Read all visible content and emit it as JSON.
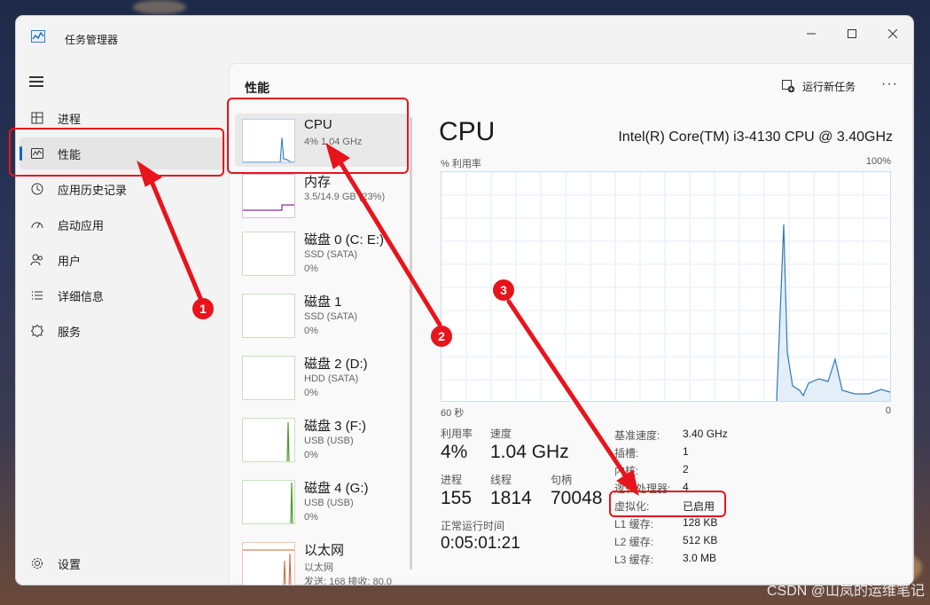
{
  "window": {
    "title": "任务管理器",
    "accent": "#0067c0"
  },
  "nav": {
    "items": [
      {
        "label": "进程",
        "icon": "processes-icon"
      },
      {
        "label": "性能",
        "icon": "performance-icon",
        "active": true
      },
      {
        "label": "应用历史记录",
        "icon": "history-icon"
      },
      {
        "label": "启动应用",
        "icon": "startup-icon"
      },
      {
        "label": "用户",
        "icon": "users-icon"
      },
      {
        "label": "详细信息",
        "icon": "details-icon"
      },
      {
        "label": "服务",
        "icon": "services-icon"
      }
    ],
    "settings": "设置"
  },
  "header": {
    "title": "性能",
    "run_task": "运行新任务",
    "more": "···"
  },
  "resources": [
    {
      "name": "CPU",
      "sub1": "4% 1.04 GHz",
      "sub2": ""
    },
    {
      "name": "内存",
      "sub1": "3.5/14.9 GB (23%)",
      "sub2": ""
    },
    {
      "name": "磁盘 0 (C: E:)",
      "sub1": "SSD (SATA)",
      "sub2": "0%"
    },
    {
      "name": "磁盘 1",
      "sub1": "SSD (SATA)",
      "sub2": "0%"
    },
    {
      "name": "磁盘 2 (D:)",
      "sub1": "HDD (SATA)",
      "sub2": "0%"
    },
    {
      "name": "磁盘 3 (F:)",
      "sub1": "USB (USB)",
      "sub2": "0%"
    },
    {
      "name": "磁盘 4 (G:)",
      "sub1": "USB (USB)",
      "sub2": "0%"
    },
    {
      "name": "以太网",
      "sub1": "以太网",
      "sub2": "发送: 168 接收: 80.0"
    }
  ],
  "detail": {
    "title": "CPU",
    "model": "Intel(R) Core(TM) i3-4130 CPU @ 3.40GHz",
    "util_label": "% 利用率",
    "max_label": "100%",
    "time_left": "60 秒",
    "time_right": "0",
    "stats": {
      "util_label": "利用率",
      "util_value": "4%",
      "speed_label": "速度",
      "speed_value": "1.04 GHz",
      "proc_label": "进程",
      "proc_value": "155",
      "thread_label": "线程",
      "thread_value": "1814",
      "handle_label": "句柄",
      "handle_value": "70048",
      "uptime_label": "正常运行时间",
      "uptime_value": "0:05:01:21"
    },
    "specs": [
      {
        "label": "基准速度:",
        "value": "3.40 GHz"
      },
      {
        "label": "插槽:",
        "value": "1"
      },
      {
        "label": "内核:",
        "value": "2"
      },
      {
        "label": "逻辑处理器:",
        "value": "4"
      },
      {
        "label": "虚拟化:",
        "value": "已启用"
      },
      {
        "label": "L1 缓存:",
        "value": "128 KB"
      },
      {
        "label": "L2 缓存:",
        "value": "512 KB"
      },
      {
        "label": "L3 缓存:",
        "value": "3.0 MB"
      }
    ]
  },
  "annotations": {
    "badge1": "1",
    "badge2": "2",
    "badge3": "3",
    "color": "#e8141c"
  },
  "watermark": "CSDN @山岚的运维笔记"
}
